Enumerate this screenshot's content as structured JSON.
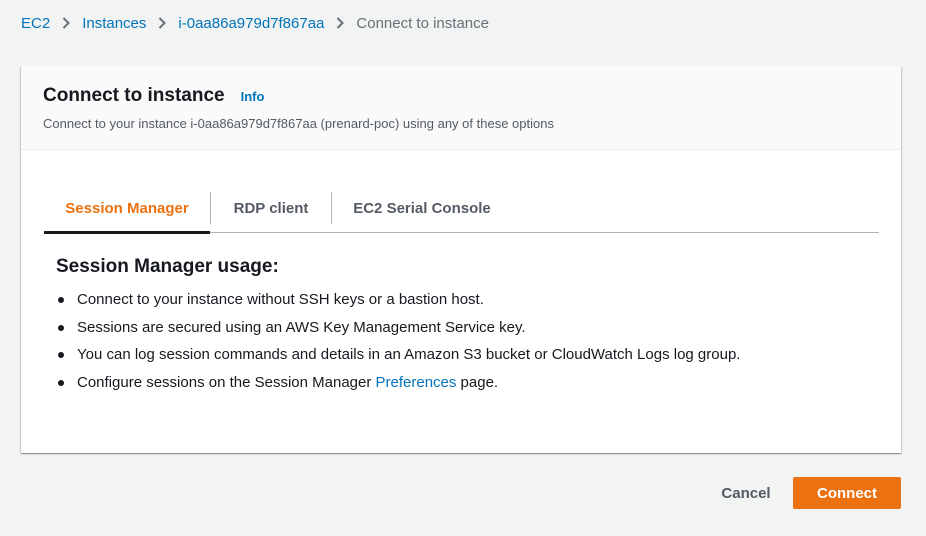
{
  "breadcrumb": {
    "items": [
      {
        "label": "EC2"
      },
      {
        "label": "Instances"
      },
      {
        "label": "i-0aa86a979d7f867aa"
      },
      {
        "label": "Connect to instance"
      }
    ]
  },
  "panel": {
    "title": "Connect to instance",
    "info_label": "Info",
    "description": "Connect to your instance i-0aa86a979d7f867aa (prenard-poc) using any of these options"
  },
  "tabs": [
    {
      "label": "Session Manager",
      "active": true
    },
    {
      "label": "RDP client",
      "active": false
    },
    {
      "label": "EC2 Serial Console",
      "active": false
    }
  ],
  "session_manager": {
    "heading": "Session Manager usage:",
    "bullets": [
      "Connect to your instance without SSH keys or a bastion host.",
      "Sessions are secured using an AWS Key Management Service key.",
      "You can log session commands and details in an Amazon S3 bucket or CloudWatch Logs log group."
    ],
    "last_bullet": {
      "prefix": "Configure sessions on the Session Manager ",
      "link": "Preferences",
      "suffix": " page."
    }
  },
  "footer": {
    "cancel_label": "Cancel",
    "connect_label": "Connect"
  },
  "colors": {
    "accent": "#ec7211",
    "link": "#0073bb",
    "background": "#f2f3f3"
  },
  "icons": {
    "breadcrumb_separator": "chevron-right-icon"
  }
}
